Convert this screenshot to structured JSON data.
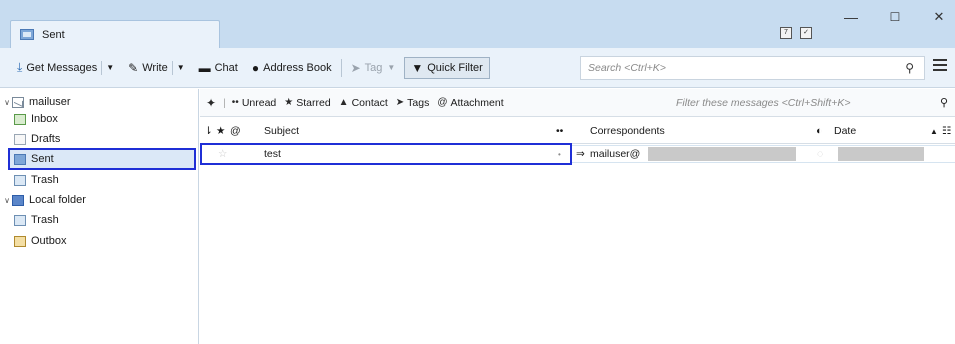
{
  "tab": {
    "label": "Sent"
  },
  "window": {
    "minimize": "—",
    "maximize": "☐",
    "close": "✕"
  },
  "toolbar": {
    "get_messages": "Get Messages",
    "write": "Write",
    "chat": "Chat",
    "address_book": "Address Book",
    "tag": "Tag",
    "quick_filter": "Quick Filter",
    "search_placeholder": "Search <Ctrl+K>"
  },
  "folders": [
    {
      "label": "mailuser"
    },
    {
      "label": "Inbox"
    },
    {
      "label": "Drafts"
    },
    {
      "label": "Sent"
    },
    {
      "label": "Trash"
    },
    {
      "label": "Local folder"
    },
    {
      "label": "Trash"
    },
    {
      "label": "Outbox"
    }
  ],
  "quickbar": {
    "unread": "Unread",
    "starred": "Starred",
    "contact": "Contact",
    "tags": "Tags",
    "attachment": "Attachment",
    "filter_placeholder": "Filter these messages <Ctrl+Shift+K>"
  },
  "columns": {
    "subject": "Subject",
    "correspondents": "Correspondents",
    "date": "Date"
  },
  "messages": [
    {
      "subject": "test",
      "correspondent": "mailuser@"
    }
  ]
}
